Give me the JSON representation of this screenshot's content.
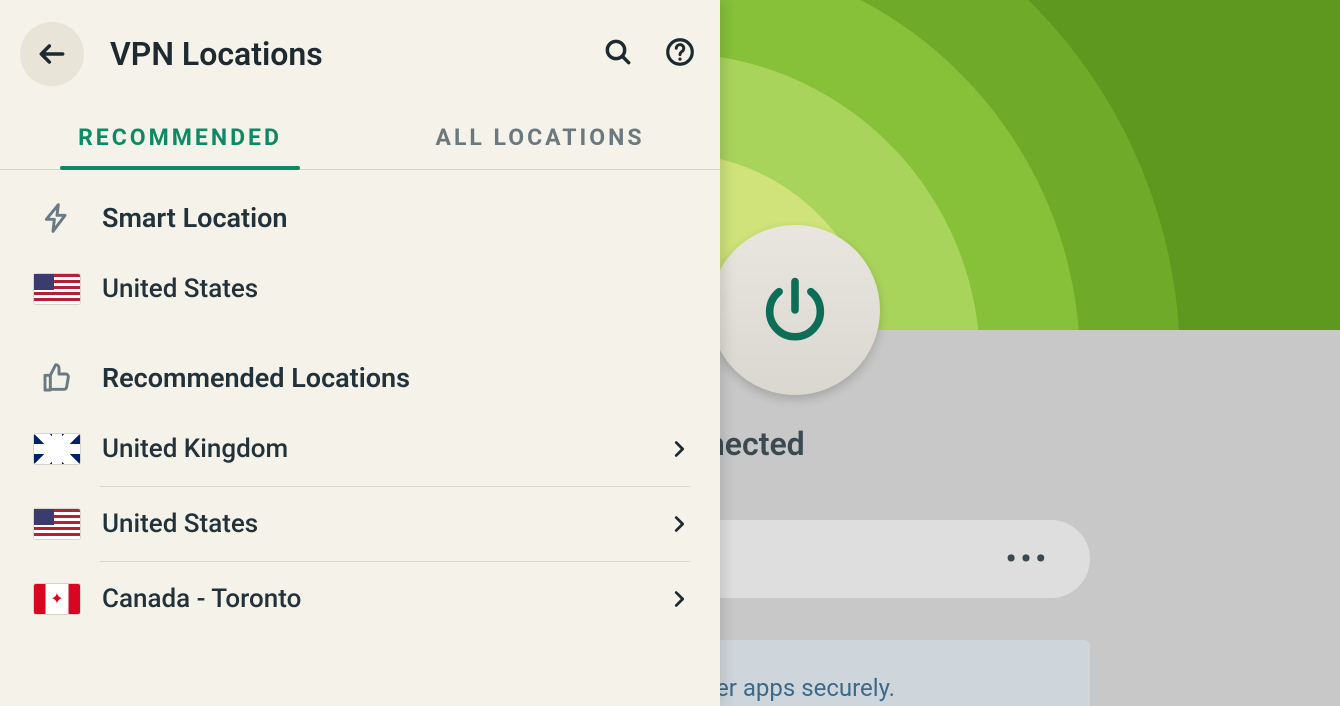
{
  "header": {
    "title": "VPN Locations"
  },
  "tabs": {
    "recommended": "RECOMMENDED",
    "all": "ALL LOCATIONS"
  },
  "sections": {
    "smart_title": "Smart Location",
    "smart_item": "United States",
    "recommended_title": "Recommended Locations",
    "items": [
      {
        "label": "United Kingdom"
      },
      {
        "label": "United States"
      },
      {
        "label": "Canada - Toronto"
      }
    ]
  },
  "main": {
    "status": "Connected",
    "more": "•••",
    "info_tail": "ther apps securely."
  }
}
